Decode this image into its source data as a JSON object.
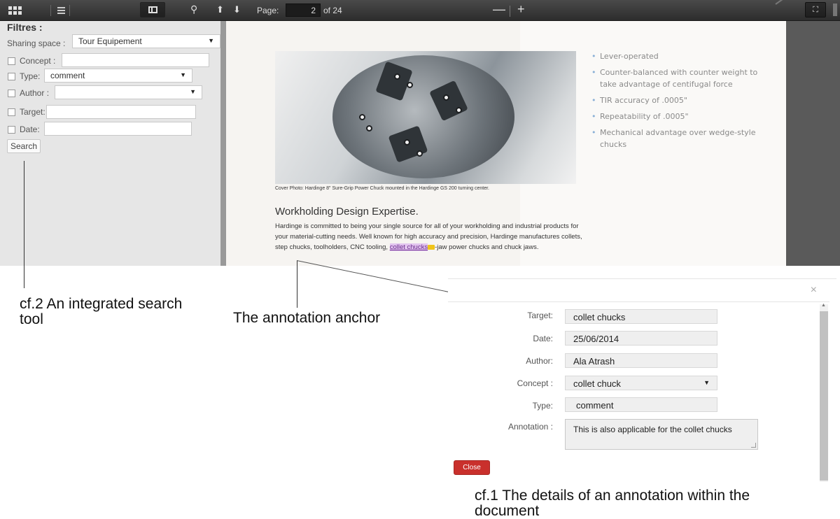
{
  "toolbar": {
    "page_label": "Page:",
    "page_value": "2",
    "page_total": "of 24",
    "zoom_out": "—",
    "zoom_in": "+"
  },
  "filters": {
    "title": "Filtres :",
    "sharing_space_label": "Sharing space :",
    "sharing_space_value": "Tour Equipement",
    "concept_label": "Concept :",
    "concept_value": "",
    "type_label": "Type:",
    "type_value": "comment",
    "author_label": "Author :",
    "author_value": "",
    "target_label": "Target:",
    "target_value": "",
    "date_label": "Date:",
    "date_value": "",
    "search_button": "Search"
  },
  "document": {
    "caption": "Cover Photo: Hardinge 8\" Sure-Grip Power Chuck mounted in the Hardinge GS 200 turning center.",
    "heading": "Workholding Design Expertise.",
    "paragraph_start": "Hardinge is committed to being your single source for all of your workholding and industrial products for your material-cutting needs. Well known for high accuracy and precision, Hardinge manufactures collets, step chucks, toolholders, CNC tooling,",
    "anchor_text": "collet chucks",
    "paragraph_end": "-jaw power chucks and chuck jaws.",
    "bullets": [
      "Lever-operated",
      "Counter-balanced with counter weight to take advantage of centifugal force",
      "TIR accuracy of .0005\"",
      "Repeatability of .0005\"",
      "Mechanical advantage over wedge-style chucks"
    ]
  },
  "labels": {
    "search_tool": "cf.2 An integrated search tool",
    "anchor": "The annotation anchor",
    "details": "cf.1 The details of an annotation within the document"
  },
  "dialog": {
    "close_x": "×",
    "target_label": "Target:",
    "target_value": "collet chucks",
    "date_label": "Date:",
    "date_value": "25/06/2014",
    "author_label": "Author:",
    "author_value": "Ala Atrash",
    "concept_label": "Concept :",
    "concept_value": "collet chuck",
    "type_label": "Type:",
    "type_value": "comment",
    "annotation_label": "Annotation :",
    "annotation_value": "This is also applicable for the collet chucks",
    "close_button": "Close"
  },
  "colors": {
    "toolbar_bg": "#333333",
    "sidebar_bg": "#e6e6e6",
    "anchor_highlight": "#e2c4ef",
    "close_button": "#c9302c",
    "bullet_accent": "#8ab0d6"
  },
  "icons": [
    "grid-view-icon",
    "list-view-icon",
    "sidebar-toggle-icon",
    "search-icon",
    "arrow-up-icon",
    "arrow-down-icon",
    "fullscreen-icon",
    "close-icon",
    "dropdown-caret-icon",
    "annotation-note-icon"
  ]
}
